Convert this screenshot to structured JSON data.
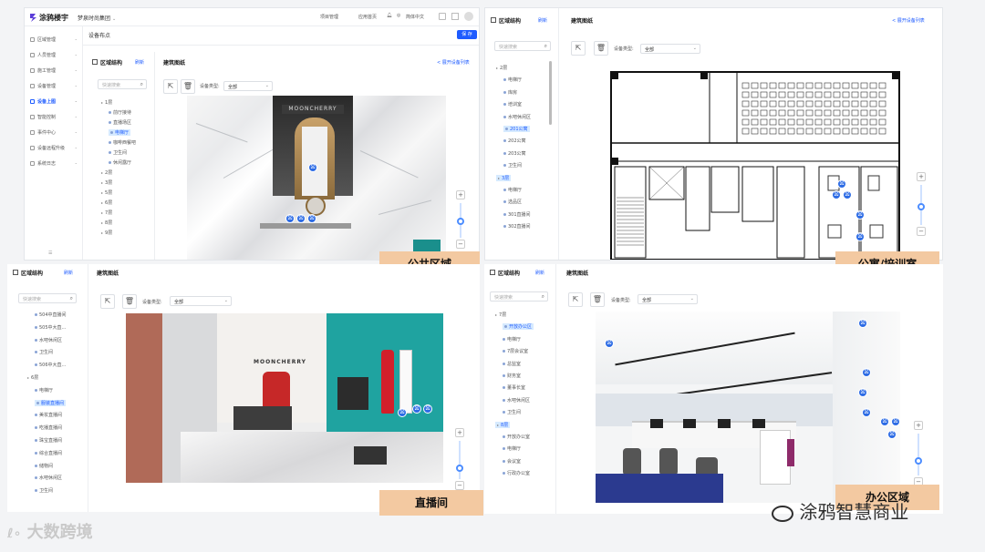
{
  "panel_main": {
    "brand": "涂鸦楼宇",
    "group": "梦泉时尚集团",
    "top_menu": [
      "项目管理",
      "应用首页",
      "简体中文"
    ],
    "menu": [
      {
        "label": "区域管理",
        "active": false
      },
      {
        "label": "人员管理",
        "active": false
      },
      {
        "label": "施工管理",
        "active": false
      },
      {
        "label": "设备管理",
        "active": false
      },
      {
        "label": "设备上图",
        "active": true
      },
      {
        "label": "智能控制",
        "active": false
      },
      {
        "label": "事件中心",
        "active": false
      },
      {
        "label": "设备远程升级",
        "active": false
      },
      {
        "label": "系统日志",
        "active": false
      }
    ],
    "breadcrumb": "设备布点",
    "save_label": "保 存",
    "area_title": "区域结构",
    "refresh": "刷新",
    "search_placeholder": "快速搜索",
    "tree": [
      {
        "label": "1层",
        "level": 0,
        "type": "group"
      },
      {
        "label": "前厅接待",
        "level": 1,
        "type": "leaf"
      },
      {
        "label": "直播场区",
        "level": 1,
        "type": "leaf"
      },
      {
        "label": "电梯厅",
        "level": 1,
        "type": "leaf",
        "selected": true
      },
      {
        "label": "咖啡西餐吧",
        "level": 1,
        "type": "leaf"
      },
      {
        "label": "卫生间",
        "level": 1,
        "type": "leaf"
      },
      {
        "label": "休闲露厅",
        "level": 1,
        "type": "leaf"
      },
      {
        "label": "2层",
        "level": 0,
        "type": "group"
      },
      {
        "label": "3层",
        "level": 0,
        "type": "group"
      },
      {
        "label": "5层",
        "level": 0,
        "type": "group"
      },
      {
        "label": "6层",
        "level": 0,
        "type": "group"
      },
      {
        "label": "7层",
        "level": 0,
        "type": "group"
      },
      {
        "label": "8层",
        "level": 0,
        "type": "group"
      },
      {
        "label": "9层",
        "level": 0,
        "type": "group"
      }
    ],
    "drawing_title": "建筑图纸",
    "expand_link": "< 展开设备列表",
    "device_type_label": "设备类型:",
    "device_type_value": "全部",
    "scene_sign": "MOONCHERRY",
    "caption": "公共区域"
  },
  "panel_apartment": {
    "area_title": "区域结构",
    "refresh": "刷新",
    "search_placeholder": "快速搜索",
    "tree": [
      {
        "label": "2层",
        "level": 0,
        "type": "group"
      },
      {
        "label": "电梯厅",
        "level": 1,
        "type": "leaf"
      },
      {
        "label": "库房",
        "level": 1,
        "type": "leaf"
      },
      {
        "label": "培训室",
        "level": 1,
        "type": "leaf"
      },
      {
        "label": "水吧休闲区",
        "level": 1,
        "type": "leaf"
      },
      {
        "label": "201公寓",
        "level": 1,
        "type": "leaf",
        "selected": true
      },
      {
        "label": "202公寓",
        "level": 1,
        "type": "leaf"
      },
      {
        "label": "203公寓",
        "level": 1,
        "type": "leaf"
      },
      {
        "label": "卫生间",
        "level": 1,
        "type": "leaf"
      },
      {
        "label": "3层",
        "level": 0,
        "type": "group",
        "selected": true
      },
      {
        "label": "电梯厅",
        "level": 1,
        "type": "leaf"
      },
      {
        "label": "选品区",
        "level": 1,
        "type": "leaf"
      },
      {
        "label": "301直播间",
        "level": 1,
        "type": "leaf"
      },
      {
        "label": "302直播间",
        "level": 1,
        "type": "leaf"
      }
    ],
    "drawing_title": "建筑图纸",
    "expand_link": "< 展开设备列表",
    "device_type_label": "设备类型:",
    "device_type_value": "全部",
    "caption": "公寓/培训室"
  },
  "panel_live": {
    "area_title": "区域结构",
    "refresh": "刷新",
    "search_placeholder": "快速搜索",
    "tree": [
      {
        "label": "504中直播间",
        "level": 1,
        "type": "leaf"
      },
      {
        "label": "505中大直...",
        "level": 1,
        "type": "leaf"
      },
      {
        "label": "水吧休闲区",
        "level": 1,
        "type": "leaf"
      },
      {
        "label": "卫生间",
        "level": 1,
        "type": "leaf"
      },
      {
        "label": "506中大直...",
        "level": 1,
        "type": "leaf"
      },
      {
        "label": "6层",
        "level": 0,
        "type": "group"
      },
      {
        "label": "电梯厅",
        "level": 1,
        "type": "leaf"
      },
      {
        "label": "服装直播间",
        "level": 1,
        "type": "leaf",
        "selected": true
      },
      {
        "label": "美妆直播间",
        "level": 1,
        "type": "leaf"
      },
      {
        "label": "吃播直播间",
        "level": 1,
        "type": "leaf"
      },
      {
        "label": "珠宝直播间",
        "level": 1,
        "type": "leaf"
      },
      {
        "label": "综合直播间",
        "level": 1,
        "type": "leaf"
      },
      {
        "label": "储物间",
        "level": 1,
        "type": "leaf"
      },
      {
        "label": "水吧休闲区",
        "level": 1,
        "type": "leaf"
      },
      {
        "label": "卫生间",
        "level": 1,
        "type": "leaf"
      }
    ],
    "drawing_title": "建筑图纸",
    "device_type_label": "设备类型:",
    "device_type_value": "全部",
    "scene_sign": "MOONCHERRY",
    "caption": "直播间"
  },
  "panel_office": {
    "area_title": "区域结构",
    "refresh": "刷新",
    "search_placeholder": "快速搜索",
    "tree": [
      {
        "label": "7层",
        "level": 0,
        "type": "group"
      },
      {
        "label": "开放办公区",
        "level": 1,
        "type": "leaf",
        "selected": true
      },
      {
        "label": "电梯厅",
        "level": 1,
        "type": "leaf"
      },
      {
        "label": "7层会议室",
        "level": 1,
        "type": "leaf"
      },
      {
        "label": "总监室",
        "level": 1,
        "type": "leaf"
      },
      {
        "label": "财务室",
        "level": 1,
        "type": "leaf"
      },
      {
        "label": "董事长室",
        "level": 1,
        "type": "leaf"
      },
      {
        "label": "水吧休闲区",
        "level": 1,
        "type": "leaf"
      },
      {
        "label": "卫生间",
        "level": 1,
        "type": "leaf"
      },
      {
        "label": "8层",
        "level": 0,
        "type": "group",
        "selected": true
      },
      {
        "label": "开放办公室",
        "level": 1,
        "type": "leaf"
      },
      {
        "label": "电梯厅",
        "level": 1,
        "type": "leaf"
      },
      {
        "label": "会议室",
        "level": 1,
        "type": "leaf"
      },
      {
        "label": "行政办公室",
        "level": 1,
        "type": "leaf"
      }
    ],
    "drawing_title": "建筑图纸",
    "device_type_label": "设备类型:",
    "device_type_value": "全部",
    "caption": "办公区域"
  },
  "watermark_left": "大数跨境",
  "watermark_right": "涂鸦智慧商业"
}
